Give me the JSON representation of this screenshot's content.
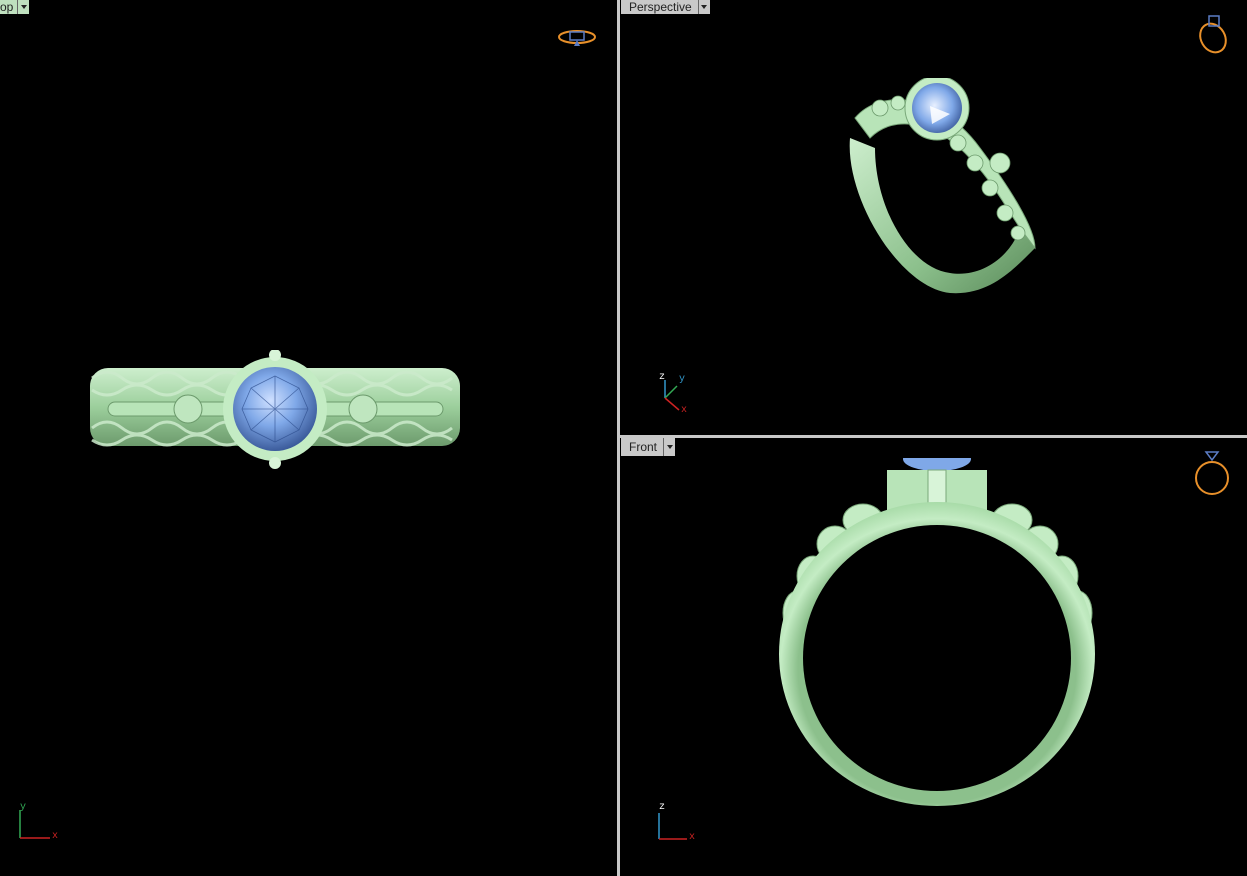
{
  "viewports": {
    "top": {
      "name": "Top",
      "tab_label": "op",
      "axes": [
        "y",
        "x"
      ]
    },
    "perspective": {
      "name": "Perspective",
      "tab_label": "Perspective",
      "axes": [
        "z",
        "y",
        "x"
      ]
    },
    "front": {
      "name": "Front",
      "tab_label": "Front",
      "axes": [
        "z",
        "x"
      ]
    }
  },
  "colors": {
    "background": "#000000",
    "metal": "#a8dba8",
    "gem": "#7fa8e8",
    "axis_x": "#cc2222",
    "axis_y": "#33aa55",
    "axis_z": "#3399cc",
    "nav_icon": "#e8902a",
    "top_tab": "#bfe0bf",
    "tab": "#c9c9c9"
  },
  "icons": {
    "viewport_menu": "chevron-down-icon",
    "view_widget": "ring-orientation-icon"
  }
}
